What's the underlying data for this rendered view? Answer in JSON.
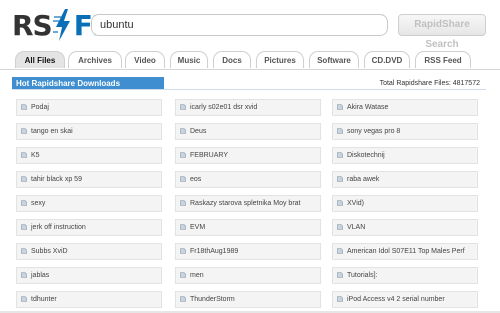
{
  "logo": {
    "part1": "RS",
    "part2": "FIND"
  },
  "search": {
    "value": "ubuntu",
    "button_label": "RapidShare Search"
  },
  "tabs": [
    {
      "label": "All Files",
      "active": true
    },
    {
      "label": "Archives"
    },
    {
      "label": "Video"
    },
    {
      "label": "Music"
    },
    {
      "label": "Docs"
    },
    {
      "label": "Pictures"
    },
    {
      "label": "Software"
    },
    {
      "label": "CD.DVD"
    },
    {
      "label": "RSS Feed"
    }
  ],
  "section": {
    "title": "Hot Rapidshare Downloads",
    "total_label": "Total Rapidshare Files: 4817572"
  },
  "results": {
    "col1": [
      "Podaj",
      "tango en skai",
      "K5",
      "tahir black xp 59",
      "sexy",
      "jerk off instruction",
      "Subbs XviD",
      "jablas",
      "tdhunter"
    ],
    "col2": [
      "icarly s02e01 dsr xvid",
      "Deus",
      "FEBRUARY",
      "eos",
      "Raskazy starova spletnika Moy brat",
      "EVM",
      "Fr18thAug1989",
      "men",
      "ThunderStorm"
    ],
    "col3": [
      "Akira Watase",
      "sony vegas pro 8",
      "Diskotechnij",
      "raba awek",
      "XVid)",
      "VLAN",
      "American Idol S07E11 Top Males Perf",
      "Tutorials]:",
      "iPod Access v4 2 serial number"
    ]
  },
  "icons": {
    "result_icon": "file-icon",
    "bolt": "lightning-bolt-icon"
  },
  "colors": {
    "brand": "#0b6fb8",
    "section_bar": "#3f8fd0",
    "cell_bg": "#f4f4f4"
  }
}
